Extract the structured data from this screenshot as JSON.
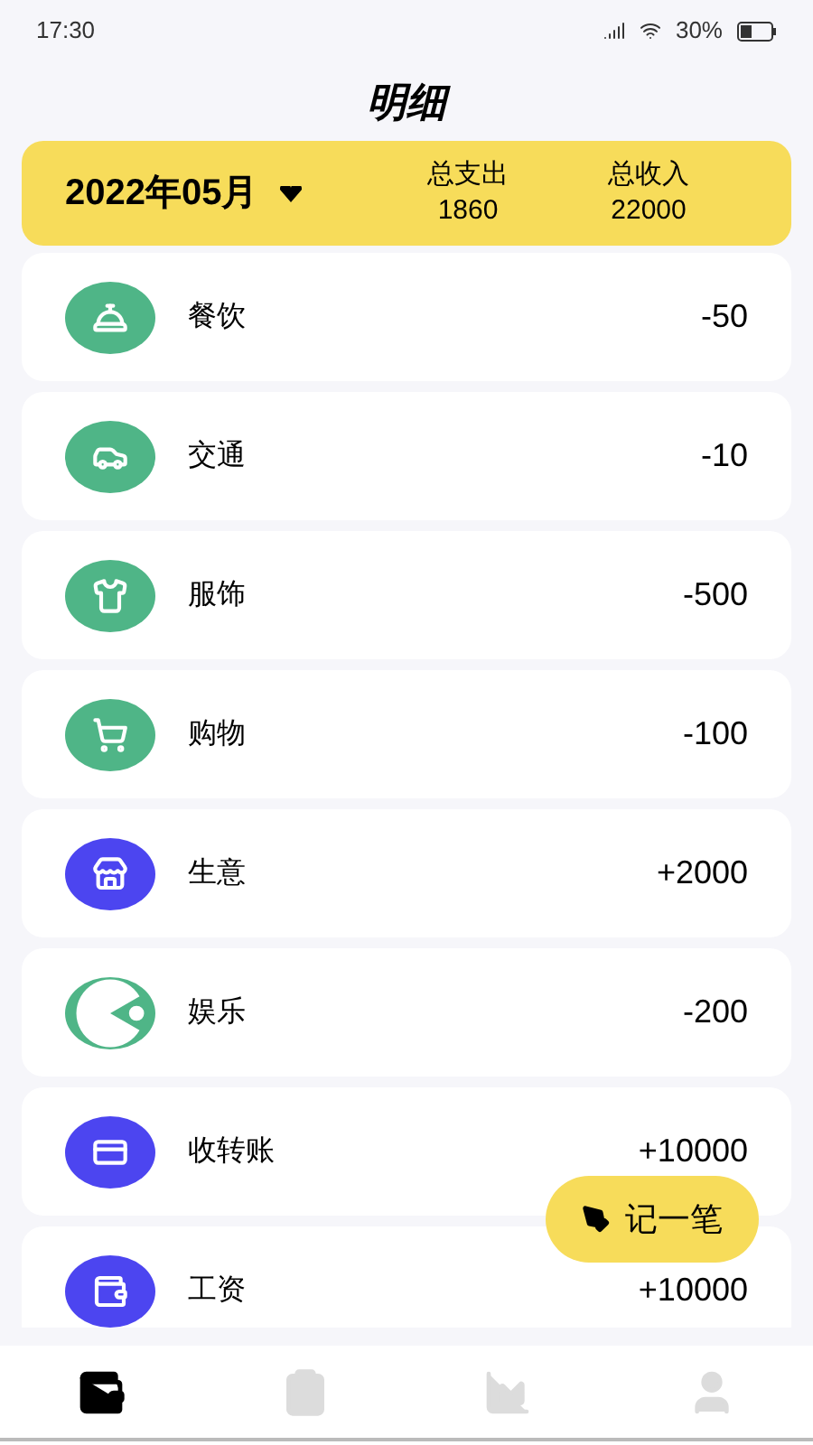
{
  "status_bar": {
    "time": "17:30",
    "battery": "30%"
  },
  "title": "明细",
  "summary": {
    "month": "2022年05月",
    "expense_label": "总支出",
    "expense": "1860",
    "income_label": "总收入",
    "income": "22000"
  },
  "entries": [
    {
      "category": "餐饮",
      "amount": "-50",
      "color": "#4fb587"
    },
    {
      "category": "交通",
      "amount": "-10",
      "color": "#4fb587"
    },
    {
      "category": "服饰",
      "amount": "-500",
      "color": "#4fb587"
    },
    {
      "category": "购物",
      "amount": "-100",
      "color": "#4fb587"
    },
    {
      "category": "生意",
      "amount": "+2000",
      "color": "#4c45f0"
    },
    {
      "category": "娱乐",
      "amount": "-200",
      "color": "#4fb587"
    },
    {
      "category": "收转账",
      "amount": "+10000",
      "color": "#4c45f0"
    },
    {
      "category": "工资",
      "amount": "+10000",
      "color": "#4c45f0"
    }
  ],
  "add_button": "记一笔",
  "nav": [
    {
      "selected": true
    },
    {
      "selected": false
    },
    {
      "selected": false
    },
    {
      "selected": false
    }
  ]
}
